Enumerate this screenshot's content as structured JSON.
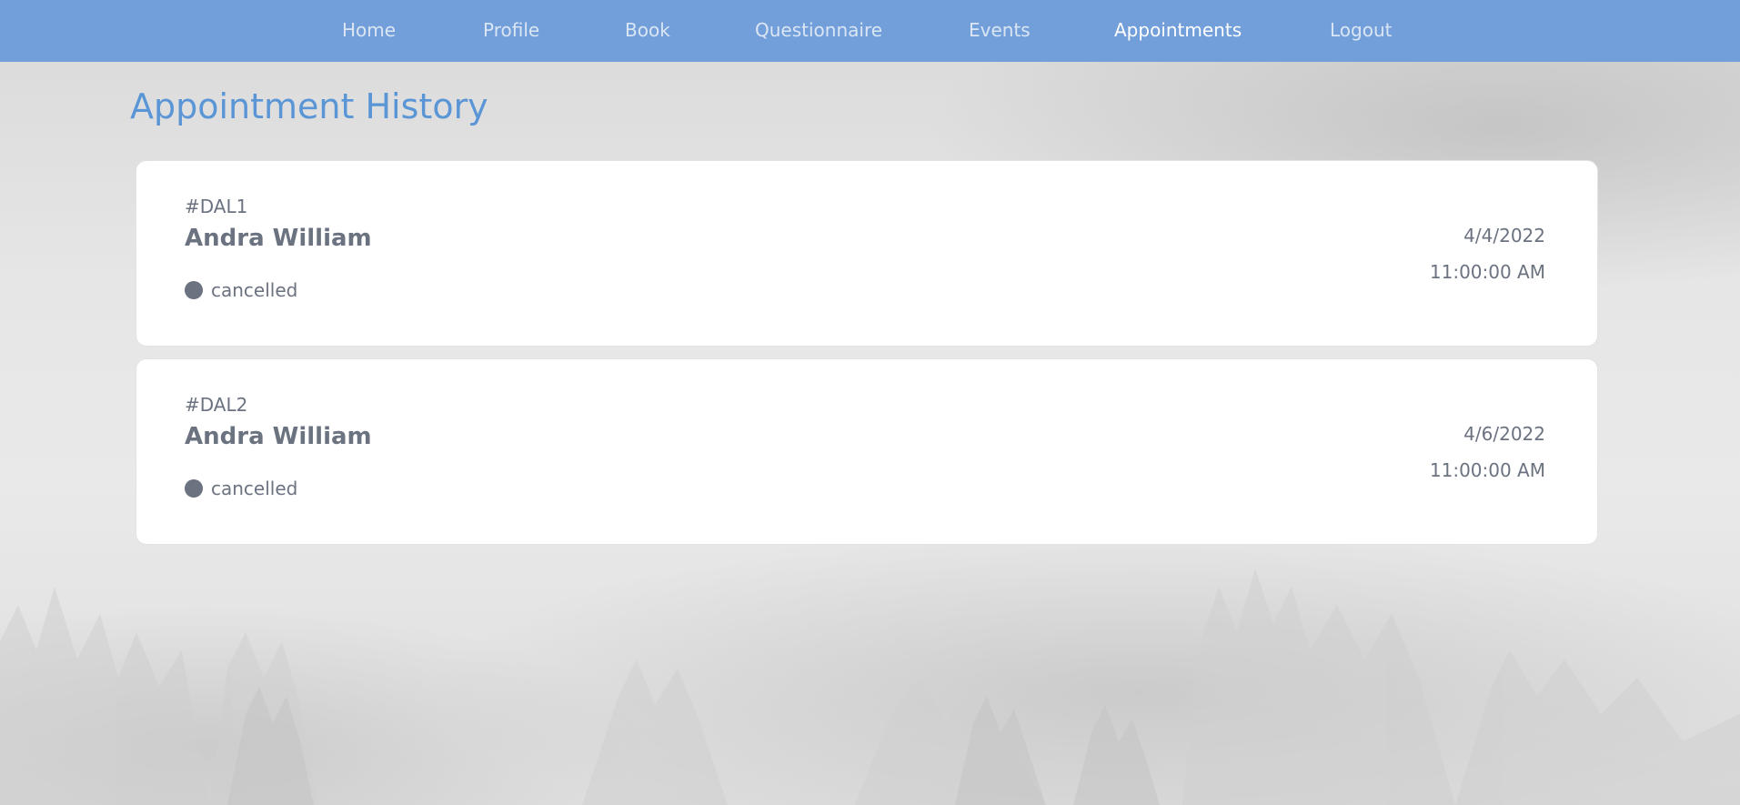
{
  "nav": {
    "items": [
      {
        "label": "Home"
      },
      {
        "label": "Profile"
      },
      {
        "label": "Book"
      },
      {
        "label": "Questionnaire"
      },
      {
        "label": "Events"
      },
      {
        "label": "Appointments",
        "active": true
      },
      {
        "label": "Logout"
      }
    ]
  },
  "page": {
    "title": "Appointment History"
  },
  "appointments": [
    {
      "id": "#DAL1",
      "name": "Andra William",
      "status": "cancelled",
      "date": "4/4/2022",
      "time": "11:00:00 AM"
    },
    {
      "id": "#DAL2",
      "name": "Andra William",
      "status": "cancelled",
      "date": "4/6/2022",
      "time": "11:00:00 AM"
    }
  ],
  "colors": {
    "navbar": "#729fd9",
    "title": "#5a95d6",
    "text_muted": "#6b7280",
    "status_cancelled": "#6b7280"
  }
}
